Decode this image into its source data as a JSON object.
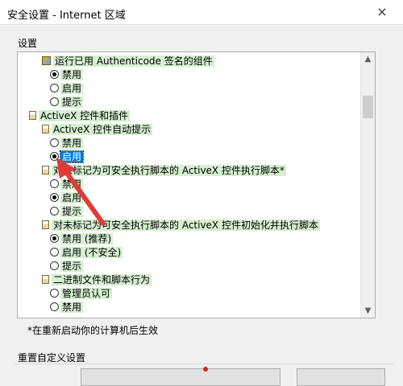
{
  "window": {
    "title": "安全设置 - Internet 区域",
    "close_glyph": "×"
  },
  "settings_group_label": "设置",
  "tree": [
    {
      "kind": "cert",
      "label": "运行已用 Authenticode 签名的组件"
    },
    {
      "kind": "radio",
      "label": "禁用",
      "checked": true
    },
    {
      "kind": "radio",
      "label": "启用",
      "checked": false
    },
    {
      "kind": "radio",
      "label": "提示",
      "checked": false
    },
    {
      "kind": "folder",
      "label": "ActiveX 控件和插件"
    },
    {
      "kind": "folder",
      "label": "ActiveX 控件自动提示"
    },
    {
      "kind": "radio",
      "label": "禁用",
      "checked": false
    },
    {
      "kind": "radio",
      "label": "启用",
      "checked": true,
      "selected": true
    },
    {
      "kind": "folder",
      "label": "对未标记为可安全执行脚本的 ActiveX 控件执行脚本*"
    },
    {
      "kind": "radio",
      "label": "禁用",
      "checked": false
    },
    {
      "kind": "radio",
      "label": "启用",
      "checked": true
    },
    {
      "kind": "radio",
      "label": "提示",
      "checked": false
    },
    {
      "kind": "folder",
      "label": "对未标记为可安全执行脚本的 ActiveX 控件初始化并执行脚本"
    },
    {
      "kind": "radio",
      "label": "禁用 (推荐)",
      "checked": true
    },
    {
      "kind": "radio",
      "label": "启用 (不安全)",
      "checked": false
    },
    {
      "kind": "radio",
      "label": "提示",
      "checked": false
    },
    {
      "kind": "folder",
      "label": "二进制文件和脚本行为"
    },
    {
      "kind": "radio",
      "label": "管理员认可",
      "checked": false
    },
    {
      "kind": "radio",
      "label": "禁用",
      "checked": false
    }
  ],
  "note": "*在重新启动你的计算机后生效",
  "reset_group_label": "重置自定义设置",
  "colors": {
    "highlight": "#d6efd1",
    "selected": "#0078d7",
    "annotation_arrow": "#e23b34"
  },
  "icons": {
    "scroll_up": "chevron-up-icon",
    "scroll_down": "chevron-down-icon"
  }
}
